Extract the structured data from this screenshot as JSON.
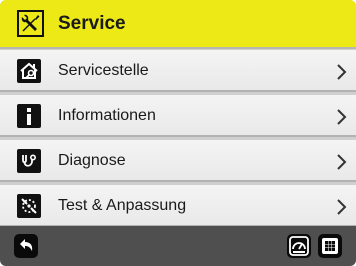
{
  "header": {
    "title": "Service",
    "icon": "tools-icon",
    "background_color": "#ece916"
  },
  "menu": {
    "items": [
      {
        "label": "Servicestelle",
        "icon": "service-house-icon"
      },
      {
        "label": "Informationen",
        "icon": "info-icon"
      },
      {
        "label": "Diagnose",
        "icon": "stethoscope-icon"
      },
      {
        "label": "Test & Anpassung",
        "icon": "calibration-icon"
      }
    ]
  },
  "footer": {
    "back_icon": "back-arrow-icon",
    "dashboard_icon": "gauge-icon",
    "grid_icon": "grid-menu-icon",
    "background_color": "#4f4f4f"
  }
}
